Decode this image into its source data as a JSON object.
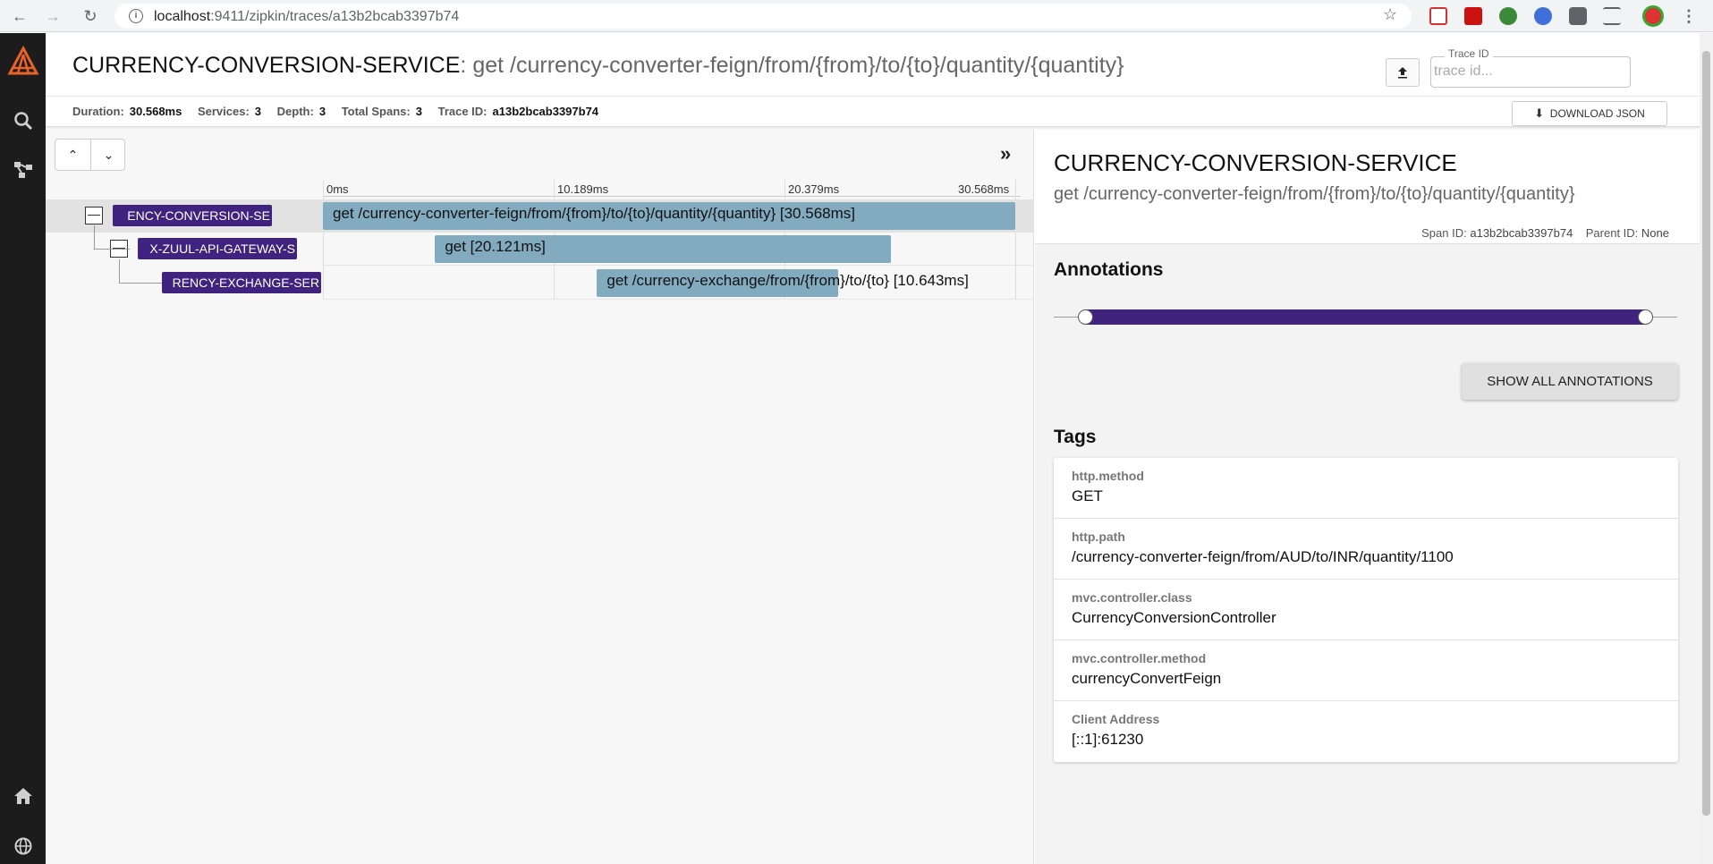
{
  "browser": {
    "url_host": "localhost",
    "url_rest": ":9411/zipkin/traces/a13b2bcab3397b74"
  },
  "header": {
    "service": "CURRENCY-CONVERSION-SERVICE",
    "separator": ": ",
    "endpoint": "get /currency-converter-feign/from/{from}/to/{to}/quantity/{quantity}",
    "trace_id_label": "Trace ID",
    "trace_id_placeholder": "trace id...",
    "download_label": "DOWNLOAD JSON",
    "stats": {
      "duration_label": "Duration:",
      "duration": "30.568ms",
      "services_label": "Services:",
      "services": "3",
      "depth_label": "Depth:",
      "depth": "3",
      "spans_label": "Total Spans:",
      "spans": "3",
      "traceid_label": "Trace ID:",
      "traceid": "a13b2bcab3397b74"
    }
  },
  "timeline": {
    "ticks": [
      "0ms",
      "10.189ms",
      "20.379ms",
      "30.568ms"
    ],
    "spans": [
      {
        "service": "CURRENCY-CONVERSION-SERVICE",
        "service_visible": "ENCY-CONVERSION-SE",
        "label": "get /currency-converter-feign/from/{from}/to/{to}/quantity/{quantity} [30.568ms]",
        "start_ms": 0,
        "duration_ms": 30.568,
        "depth": 0,
        "selected": true
      },
      {
        "service": "NETFLIX-ZUUL-API-GATEWAY-SERVER",
        "service_visible": "X-ZUUL-API-GATEWAY-S",
        "label": "get [20.121ms]",
        "start_ms": 4.95,
        "duration_ms": 20.121,
        "depth": 1,
        "selected": false
      },
      {
        "service": "CURRENCY-EXCHANGE-SERVICE",
        "service_visible": "RENCY-EXCHANGE-SER",
        "label": "get /currency-exchange/from/{from}/to/{to} [10.643ms]",
        "start_ms": 12.1,
        "duration_ms": 10.643,
        "depth": 2,
        "selected": false
      }
    ]
  },
  "detail": {
    "service": "CURRENCY-CONVERSION-SERVICE",
    "endpoint": "get /currency-converter-feign/from/{from}/to/{to}/quantity/{quantity}",
    "span_id_label": "Span ID:",
    "span_id": "a13b2bcab3397b74",
    "parent_id_label": "Parent ID:",
    "parent_id": "None",
    "annotations_title": "Annotations",
    "show_all_label": "SHOW ALL ANNOTATIONS",
    "tags_title": "Tags",
    "tags": [
      {
        "key": "http.method",
        "value": "GET"
      },
      {
        "key": "http.path",
        "value": "/currency-converter-feign/from/AUD/to/INR/quantity/1100"
      },
      {
        "key": "mvc.controller.class",
        "value": "CurrencyConversionController"
      },
      {
        "key": "mvc.controller.method",
        "value": "currencyConvertFeign"
      },
      {
        "key": "Client Address",
        "value": "[::1]:61230"
      }
    ]
  },
  "colors": {
    "service_badge": "#3f237e",
    "span_bar": "#83abc0",
    "zipkin_logo": "#e8622a"
  }
}
